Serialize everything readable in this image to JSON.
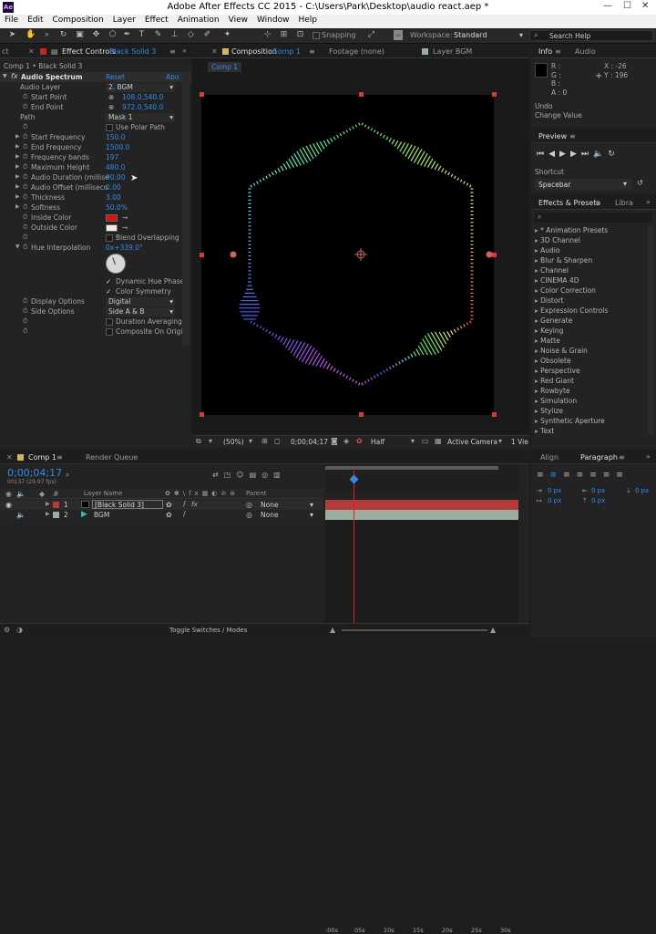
{
  "app": {
    "title": "Adobe After Effects CC 2015 - C:\\Users\\Park\\Desktop\\audio react.aep *",
    "logo": "Ae"
  },
  "menu": [
    "File",
    "Edit",
    "Composition",
    "Layer",
    "Effect",
    "Animation",
    "View",
    "Window",
    "Help"
  ],
  "toolbar": {
    "snapping_label": "Snapping",
    "workspace_label": "Workspace:",
    "workspace_value": "Standard",
    "search_placeholder": "Search Help"
  },
  "effect_controls": {
    "tab_label": "Effect Controls",
    "tab_layer": "Black Solid 3",
    "breadcrumb": "Comp 1 • Black Solid 3",
    "effect_name": "Audio Spectrum",
    "reset": "Reset",
    "about": "Abo",
    "props": {
      "audio_layer": {
        "label": "Audio Layer",
        "value": "2. BGM"
      },
      "start_point": {
        "label": "Start Point",
        "value": "108.0,540.0"
      },
      "end_point": {
        "label": "End Point",
        "value": "972.0,540.0"
      },
      "path": {
        "label": "Path",
        "value": "Mask 1"
      },
      "use_polar": {
        "label": "Use Polar Path"
      },
      "start_freq": {
        "label": "Start Frequency",
        "value": "150.0"
      },
      "end_freq": {
        "label": "End Frequency",
        "value": "1500.0"
      },
      "freq_bands": {
        "label": "Frequency bands",
        "value": "197"
      },
      "max_height": {
        "label": "Maximum Height",
        "value": "480.0"
      },
      "audio_duration": {
        "label": "Audio Duration (millise",
        "value": "90.00"
      },
      "audio_offset": {
        "label": "Audio Offset (milliseco",
        "value": "0.00"
      },
      "thickness": {
        "label": "Thickness",
        "value": "3.00"
      },
      "softness": {
        "label": "Softness",
        "value": "50.0%"
      },
      "inside_color": {
        "label": "Inside Color",
        "color": "#e01010"
      },
      "outside_color": {
        "label": "Outside Color",
        "color": "#ffe8e8"
      },
      "blend": {
        "label": "Blend Overlapping"
      },
      "hue_interp": {
        "label": "Hue Interpolation",
        "value": "0x+339.0°"
      },
      "dynamic_hue": {
        "label": "Dynamic Hue Phase"
      },
      "color_sym": {
        "label": "Color Symmetry"
      },
      "display_opts": {
        "label": "Display Options",
        "value": "Digital"
      },
      "side_opts": {
        "label": "Side Options",
        "value": "Side A & B"
      },
      "duration_avg": {
        "label": "Duration Averaging"
      },
      "composite": {
        "label": "Composite On Origi"
      }
    }
  },
  "composition": {
    "tab_label": "Composition",
    "tab_comp": "Comp 1",
    "footage_tab": "Footage (none)",
    "layer_tab": "Layer BGM",
    "comp_chip": "Comp 1",
    "zoom": "(50%)",
    "timecode": "0;00;04;17",
    "resolution": "Half",
    "camera": "Active Camera",
    "view": "1 Vie"
  },
  "info": {
    "tab": "Info",
    "audio_tab": "Audio",
    "r": "R :",
    "g": "G :",
    "b": "B :",
    "a": "A : 0",
    "x": "X : -26",
    "y": "Y : 196",
    "undo": "Undo",
    "undo_action": "Change Value"
  },
  "preview": {
    "tab": "Preview",
    "shortcut_label": "Shortcut",
    "shortcut_value": "Spacebar"
  },
  "effects_presets": {
    "tab": "Effects & Presets",
    "lib_tab": "Libra",
    "items": [
      "* Animation Presets",
      "3D Channel",
      "Audio",
      "Blur & Sharpen",
      "Channel",
      "CINEMA 4D",
      "Color Correction",
      "Distort",
      "Expression Controls",
      "Generate",
      "Keying",
      "Matte",
      "Noise & Grain",
      "Obsolete",
      "Perspective",
      "Red Giant",
      "Rowbyte",
      "Simulation",
      "Stylize",
      "Synthetic Aperture",
      "Text"
    ]
  },
  "timeline": {
    "tab": "Comp 1",
    "render_tab": "Render Queue",
    "timecode": "0;00;04;17",
    "frames": "00137 (29.97 fps)",
    "col_layer_name": "Layer Name",
    "col_parent": "Parent",
    "ruler": [
      ":00s",
      "05s",
      "10s",
      "15s",
      "20s",
      "25s",
      "30s"
    ],
    "layers": [
      {
        "num": "1",
        "name": "[Black Solid 3]",
        "parent": "None",
        "color": "#b53a3a"
      },
      {
        "num": "2",
        "name": "BGM",
        "parent": "None",
        "color": "#9aaea0"
      }
    ],
    "toggle_label": "Toggle Switches / Modes"
  },
  "align_paragraph": {
    "align_tab": "Align",
    "paragraph_tab": "Paragraph",
    "px_values": [
      "0 px",
      "0 px",
      "0 px",
      "0 px",
      "0 px"
    ]
  }
}
